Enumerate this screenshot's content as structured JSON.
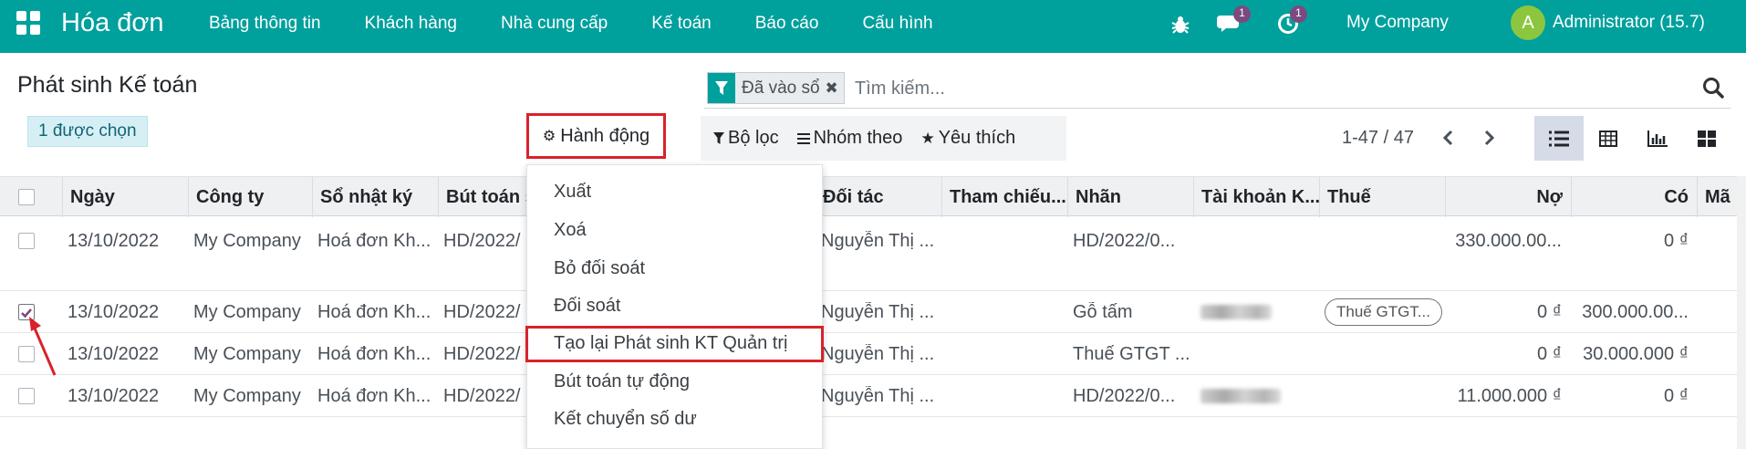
{
  "nav": {
    "app_title": "Hóa đơn",
    "menu": [
      "Bảng thông tin",
      "Khách hàng",
      "Nhà cung cấp",
      "Kế toán",
      "Báo cáo",
      "Cấu hình"
    ],
    "messages_badge": "1",
    "activities_badge": "1",
    "company": "My Company",
    "avatar_letter": "A",
    "user": "Administrator (15.7)",
    "icons": [
      "apps-grid-icon",
      "bug-icon",
      "chat-icon",
      "clock-icon"
    ]
  },
  "control": {
    "title": "Phát sinh Kế toán",
    "selected_label": "1 được chọn",
    "action_label": "Hành động",
    "facet_label": "Đã vào sổ",
    "search_placeholder": "Tìm kiếm...",
    "filter_label": "Bộ lọc",
    "group_label": "Nhóm theo",
    "favorite_label": "Yêu thích",
    "pager": "1-47 / 47"
  },
  "table": {
    "columns": [
      "Ngày",
      "Công ty",
      "Sổ nhật ký",
      "Bút toán s",
      "Đối tác",
      "Tham chiếu...",
      "Nhãn",
      "Tài khoản K...",
      "Thuế",
      "Nợ",
      "Có",
      "Mã"
    ],
    "rows": [
      {
        "date": "13/10/2022",
        "company": "My Company",
        "journal": "Hoá đơn Kh...",
        "entry": "HD/2022/",
        "partner": "Nguyễn Thị ...",
        "ref": "",
        "label": "HD/2022/0...",
        "tax": "",
        "debit": "330.000.00...",
        "credit": "0 ₫"
      },
      {
        "date": "13/10/2022",
        "company": "My Company",
        "journal": "Hoá đơn Kh...",
        "entry": "HD/2022/",
        "partner": "Nguyễn Thị ...",
        "ref": "",
        "label": "Gỗ tấm",
        "tax": "Thuế GTGT...",
        "debit": "0 ₫",
        "credit": "300.000.00..."
      },
      {
        "date": "13/10/2022",
        "company": "My Company",
        "journal": "Hoá đơn Kh...",
        "entry": "HD/2022/",
        "partner": "Nguyễn Thị ...",
        "ref": "",
        "label": "Thuế GTGT ...",
        "tax": "",
        "debit": "0 ₫",
        "credit": "30.000.000 ₫"
      },
      {
        "date": "13/10/2022",
        "company": "My Company",
        "journal": "Hoá đơn Kh...",
        "entry": "HD/2022/",
        "partner": "Nguyễn Thị ...",
        "ref": "",
        "label": "HD/2022/0...",
        "tax": "",
        "debit": "11.000.000 ₫",
        "credit": "0 ₫"
      }
    ]
  },
  "dropdown": {
    "items": [
      "Xuất",
      "Xoá",
      "Bỏ đối soát",
      "Đối soát",
      "Tạo lại Phát sinh KT Quản trị",
      "Bút toán tự động",
      "Kết chuyển số dư"
    ]
  },
  "colors": {
    "primary": "#00a09d",
    "highlight": "#d9222a",
    "badge": "#7b4a7f"
  }
}
